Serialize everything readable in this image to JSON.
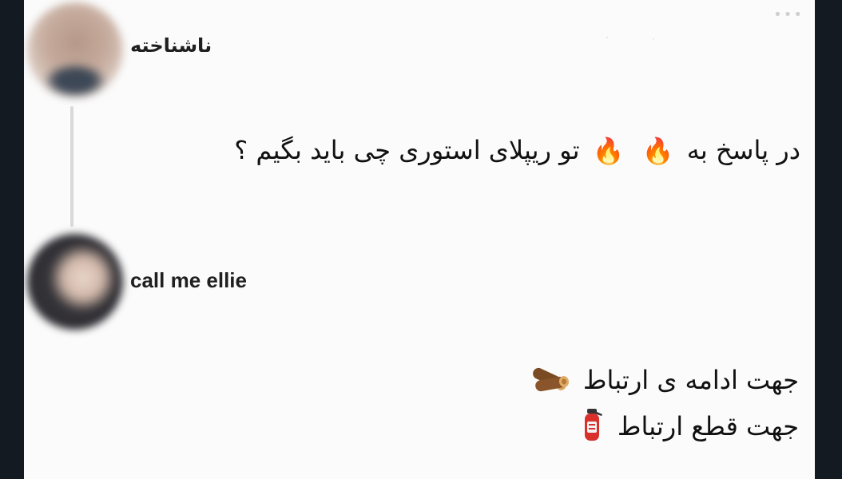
{
  "post": {
    "author": "ناشناخته",
    "text_before": "در پاسخ به",
    "emoji_1": "🔥",
    "emoji_2": "🔥",
    "text_after": "تو ریپلای استوری چی باید بگیم ؟"
  },
  "reply": {
    "author": "call me ellie",
    "line1": "جهت ادامه ی ارتباط",
    "line2": "جهت قطع ارتباط",
    "line1_icon": "firewood-icon",
    "line2_icon": "fire-extinguisher-icon"
  },
  "colors": {
    "background": "#131a22",
    "card": "#fbfbfb",
    "text": "#111111",
    "thread_line": "#d9d9d9"
  },
  "icons": {
    "more": "more-options-icon",
    "fire": "fire-icon"
  }
}
